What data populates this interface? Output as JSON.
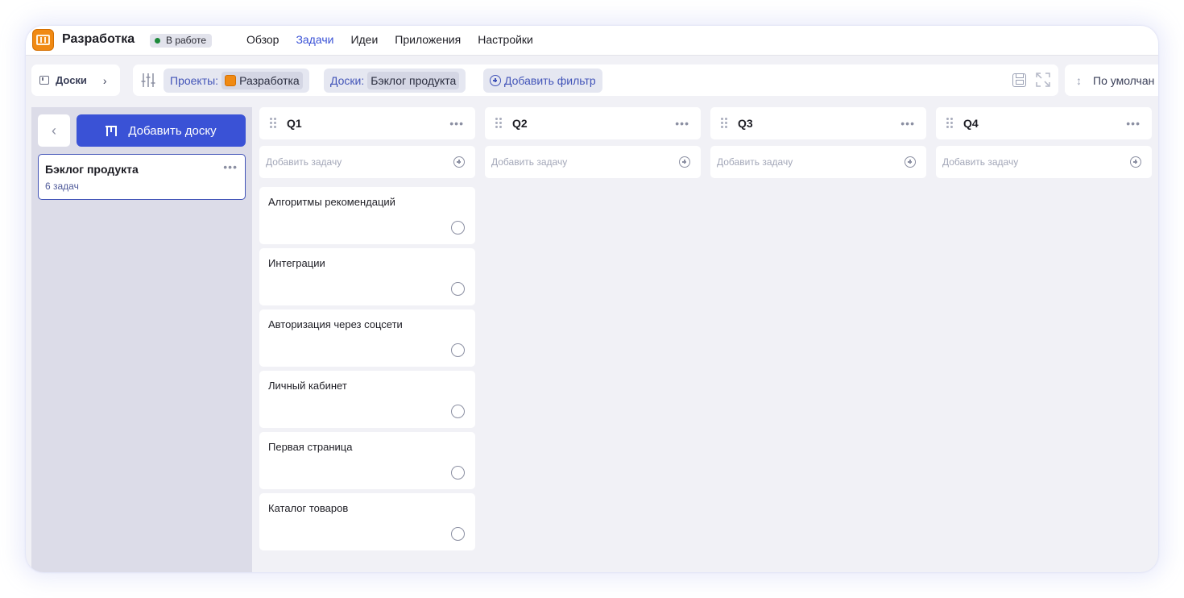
{
  "header": {
    "app_title": "Разработка",
    "status": "В работе",
    "nav": [
      "Обзор",
      "Задачи",
      "Идеи",
      "Приложения",
      "Настройки"
    ],
    "active_nav": "Задачи"
  },
  "toolbar": {
    "boards_crumb": "Доски",
    "projects_label": "Проекты:",
    "projects_value": "Разработка",
    "boards_label": "Доски:",
    "boards_value": "Бэклог продукта",
    "add_filter": "Добавить фильтр",
    "sort_label": "По умолчан"
  },
  "sidebar": {
    "add_board": "Добавить доску",
    "boards": [
      {
        "title": "Бэклог продукта",
        "count": "6 задач"
      }
    ]
  },
  "columns": [
    {
      "title": "Q1",
      "add_placeholder": "Добавить задачу"
    },
    {
      "title": "Q2",
      "add_placeholder": "Добавить задачу"
    },
    {
      "title": "Q3",
      "add_placeholder": "Добавить задачу"
    },
    {
      "title": "Q4",
      "add_placeholder": "Добавить задачу"
    }
  ],
  "tasks_q1": [
    "Алгоритмы рекомендаций",
    "Интеграции",
    "Авторизация через соцсети",
    "Личный кабинет",
    "Первая страница",
    "Каталог товаров"
  ],
  "colors": {
    "accent": "#3a52d6",
    "status_green": "#1d8a3a",
    "app_orange": "#f08a14",
    "background": "#f1f1f6"
  }
}
